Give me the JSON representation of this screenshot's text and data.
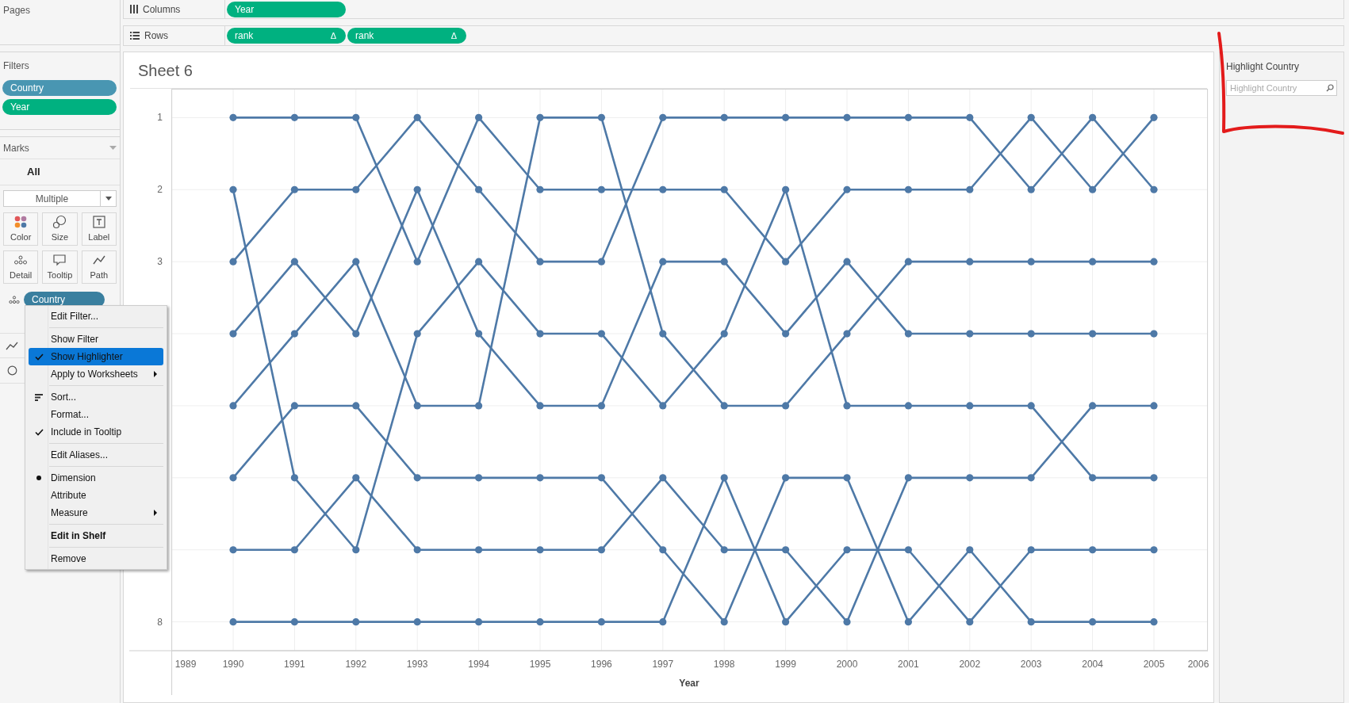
{
  "pages": {
    "title": "Pages"
  },
  "shelves": [
    {
      "kind": "columns",
      "label": "Columns",
      "pills": [
        {
          "label": "Year",
          "color": "#00b180"
        }
      ]
    },
    {
      "kind": "rows",
      "label": "Rows",
      "pills": [
        {
          "label": "rank",
          "suffix": "Δ",
          "color": "#00b180"
        },
        {
          "label": "rank",
          "suffix": "Δ",
          "color": "#00b180"
        }
      ]
    }
  ],
  "filters": {
    "title": "Filters",
    "pills": [
      {
        "label": "Country",
        "color": "#4996b2"
      },
      {
        "label": "Year",
        "color": "#00b180"
      }
    ]
  },
  "marks": {
    "title": "Marks",
    "scope": "All",
    "mark_type": "Multiple",
    "buttons": [
      {
        "label": "Color",
        "kind": "color"
      },
      {
        "label": "Size",
        "kind": "size"
      },
      {
        "label": "Label",
        "kind": "label"
      },
      {
        "label": "Detail",
        "kind": "detail"
      },
      {
        "label": "Tooltip",
        "kind": "tooltip"
      },
      {
        "label": "Path",
        "kind": "path"
      }
    ],
    "fields": [
      {
        "label": "Country",
        "kind": "detail",
        "color": "#3a7f9f"
      }
    ]
  },
  "context_menu": {
    "items": [
      {
        "kind": "item",
        "label": "Edit Filter...",
        "checked": false,
        "highlighted": false,
        "submenu": false
      },
      {
        "kind": "separator"
      },
      {
        "kind": "item",
        "label": "Show Filter",
        "checked": false,
        "highlighted": false,
        "submenu": false
      },
      {
        "kind": "item",
        "label": "Show Highlighter",
        "checked": true,
        "highlighted": true,
        "submenu": false
      },
      {
        "kind": "item",
        "label": "Apply to Worksheets",
        "checked": false,
        "highlighted": false,
        "submenu": true
      },
      {
        "kind": "separator"
      },
      {
        "kind": "sort",
        "label": "Sort...",
        "checked": false,
        "highlighted": false,
        "submenu": false
      },
      {
        "kind": "item",
        "label": "Format...",
        "checked": false,
        "highlighted": false,
        "submenu": false
      },
      {
        "kind": "item",
        "label": "Include in Tooltip",
        "checked": true,
        "highlighted": false,
        "submenu": false
      },
      {
        "kind": "separator"
      },
      {
        "kind": "item",
        "label": "Edit Aliases...",
        "checked": false,
        "highlighted": false,
        "submenu": false
      },
      {
        "kind": "separator"
      },
      {
        "kind": "radio",
        "label": "Dimension",
        "checked": true,
        "highlighted": false,
        "submenu": false
      },
      {
        "kind": "radio",
        "label": "Attribute",
        "checked": false,
        "highlighted": false,
        "submenu": false
      },
      {
        "kind": "radio",
        "label": "Measure",
        "checked": false,
        "highlighted": false,
        "submenu": true
      },
      {
        "kind": "separator"
      },
      {
        "kind": "default",
        "label": "Edit in Shelf",
        "checked": false,
        "highlighted": false,
        "submenu": false
      },
      {
        "kind": "separator"
      },
      {
        "kind": "item",
        "label": "Remove",
        "checked": false,
        "highlighted": false,
        "submenu": false
      }
    ]
  },
  "sheet": {
    "title": "Sheet 6",
    "chart_data": {
      "type": "line",
      "xlabel": "Year",
      "x": [
        1990,
        1991,
        1992,
        1993,
        1994,
        1995,
        1996,
        1997,
        1998,
        1999,
        2000,
        2001,
        2002,
        2003,
        2004,
        2005
      ],
      "xlim": [
        1989,
        2006
      ],
      "xticks": [
        1989,
        1990,
        1991,
        1992,
        1993,
        1994,
        1995,
        1996,
        1997,
        1998,
        1999,
        2000,
        2001,
        2002,
        2003,
        2004,
        2005,
        2006
      ],
      "yticks": [
        1,
        2,
        3,
        8
      ],
      "ylim": [
        8.4,
        0.6
      ],
      "grid": true,
      "series": [
        {
          "color": "#4e79a7",
          "marker": "circle",
          "values": [
            1,
            1,
            1,
            3,
            1,
            2,
            2,
            2,
            2,
            3,
            2,
            2,
            2,
            1,
            2,
            1
          ]
        },
        {
          "color": "#4e79a7",
          "marker": "circle",
          "values": [
            2,
            6,
            7,
            4,
            3,
            4,
            4,
            5,
            4,
            2,
            5,
            5,
            5,
            5,
            6,
            6
          ]
        },
        {
          "color": "#4e79a7",
          "marker": "circle",
          "values": [
            3,
            2,
            2,
            1,
            2,
            3,
            3,
            1,
            1,
            1,
            1,
            1,
            1,
            2,
            1,
            2
          ]
        },
        {
          "color": "#4e79a7",
          "marker": "circle",
          "values": [
            4,
            3,
            4,
            2,
            4,
            5,
            5,
            3,
            3,
            4,
            3,
            4,
            4,
            4,
            4,
            4
          ]
        },
        {
          "color": "#4e79a7",
          "marker": "circle",
          "values": [
            5,
            4,
            3,
            5,
            5,
            1,
            1,
            4,
            5,
            5,
            4,
            3,
            3,
            3,
            3,
            3
          ]
        },
        {
          "color": "#4e79a7",
          "marker": "circle",
          "values": [
            6,
            5,
            5,
            6,
            6,
            6,
            6,
            7,
            8,
            6,
            6,
            8,
            7,
            8,
            8,
            8
          ]
        },
        {
          "color": "#4e79a7",
          "marker": "circle",
          "values": [
            7,
            7,
            6,
            7,
            7,
            7,
            7,
            6,
            7,
            7,
            8,
            6,
            6,
            6,
            5,
            5
          ]
        },
        {
          "color": "#4e79a7",
          "marker": "circle",
          "values": [
            8,
            8,
            8,
            8,
            8,
            8,
            8,
            8,
            6,
            8,
            7,
            7,
            8,
            7,
            7,
            7
          ]
        }
      ]
    }
  },
  "highlighter": {
    "title": "Highlight Country",
    "placeholder": "Highlight Country"
  }
}
